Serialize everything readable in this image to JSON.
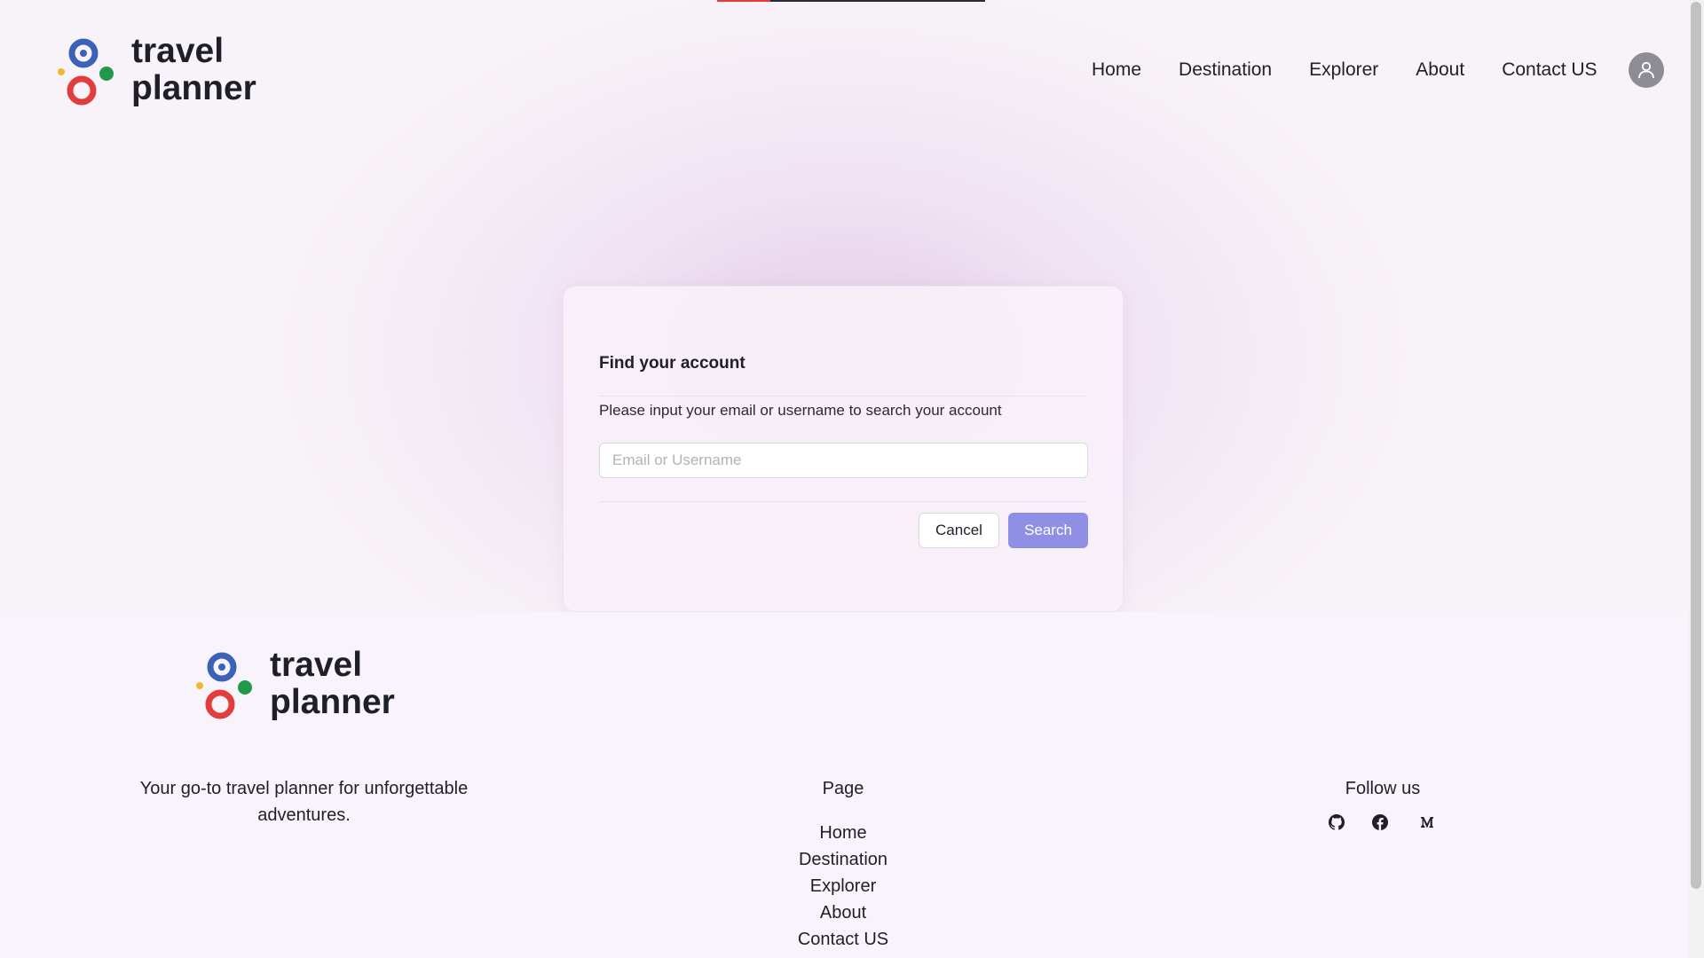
{
  "header": {
    "logo_line1": "travel",
    "logo_line2": "planner",
    "nav": [
      "Home",
      "Destination",
      "Explorer",
      "About",
      "Contact US"
    ]
  },
  "loading_progress": 0.2,
  "dialog": {
    "title": "Find your account",
    "description": "Please input your email or username to search your account",
    "input_placeholder": "Email or Username",
    "input_value": "",
    "cancel_label": "Cancel",
    "search_label": "Search"
  },
  "footer": {
    "logo_line1": "travel",
    "logo_line2": "planner",
    "tagline": "Your go-to travel planner for unforgettable adventures.",
    "page_heading": "Page",
    "page_links": [
      "Home",
      "Destination",
      "Explorer",
      "About",
      "Contact US"
    ],
    "follow_heading": "Follow us",
    "social_icons": [
      "github-icon",
      "facebook-icon",
      "medium-icon"
    ]
  },
  "colors": {
    "accent": "#8f8fe6",
    "logo_blue": "#3a63b8",
    "logo_red": "#e23c3c",
    "logo_green": "#1e9a4a",
    "logo_yellow": "#f2b829"
  }
}
